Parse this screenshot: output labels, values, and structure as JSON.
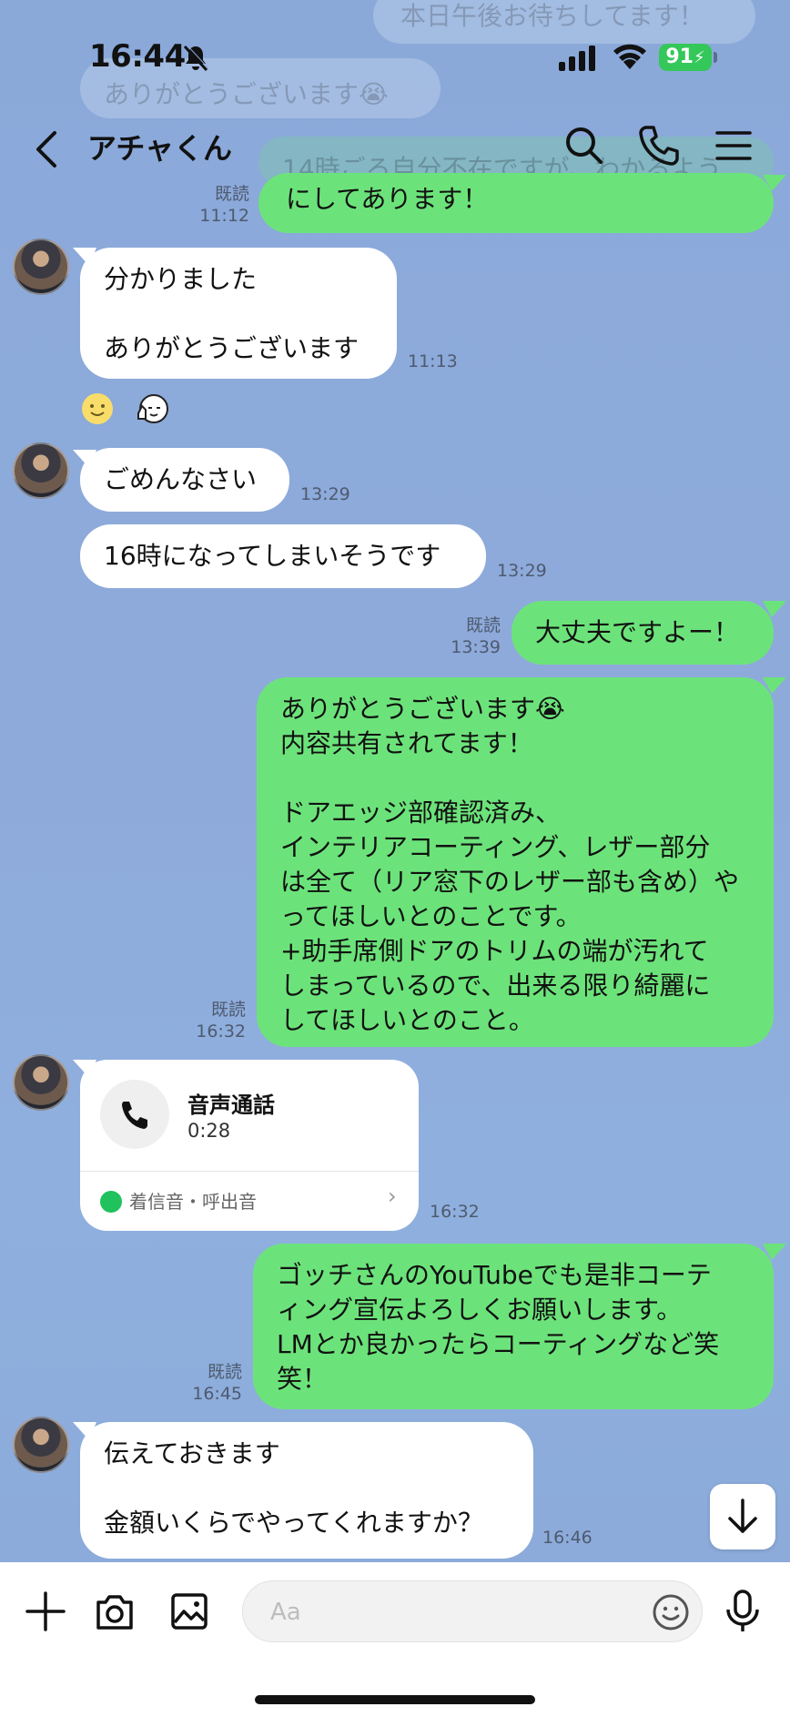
{
  "status_bar": {
    "time": "16:44",
    "battery": "91"
  },
  "header": {
    "title": "アチャくん"
  },
  "ghost": {
    "line1": "本日午後お待ちしてます！",
    "line2": "ありがとうございます😭",
    "line3": "14時ごろ自分不在ですが、わかるよう"
  },
  "messages": [
    {
      "text": "にしてあります！",
      "read": "既読",
      "time": "11:12"
    },
    {
      "text": "分かりました\n\nありがとうございます",
      "time": "11:13"
    },
    {
      "text": "ごめんなさい",
      "time": "13:29"
    },
    {
      "text": "16時になってしまいそうです",
      "time": "13:29"
    },
    {
      "text": "大丈夫ですよー！",
      "read": "既読",
      "time": "13:39"
    },
    {
      "text": "ありがとうございます😭\n内容共有されてます！\n\nドアエッジ部確認済み、\nインテリアコーティング、レザー部分\nは全て（リア窓下のレザー部も含め）や\nってほしいとのことです。\n+助手席側ドアのトリムの端が汚れて\nしまっているので、出来る限り綺麗に\nしてほしいとのこと。",
      "read": "既読",
      "time": "16:32"
    },
    {
      "call_title": "音声通話",
      "call_duration": "0:28",
      "call_footer": "着信音・呼出音",
      "time": "16:32"
    },
    {
      "text": "ゴッチさんのYouTubeでも是非コーテ\nィング宣伝よろしくお願いします。\nLMとか良かったらコーティングなど笑\n笑！",
      "read": "既読",
      "time": "16:45"
    },
    {
      "text": "伝えておきます\n\n金額いくらでやってくれますか？",
      "time": "16:46"
    }
  ],
  "composer": {
    "placeholder": "Aa"
  },
  "colors": {
    "background": "#8aa8d8",
    "outgoing": "#6ce37a",
    "incoming": "#ffffff"
  },
  "icons": [
    "back-icon",
    "search-icon",
    "phone-icon",
    "menu-icon",
    "plus-icon",
    "camera-icon",
    "image-icon",
    "emoji-icon",
    "mic-icon",
    "arrow-down-icon"
  ]
}
